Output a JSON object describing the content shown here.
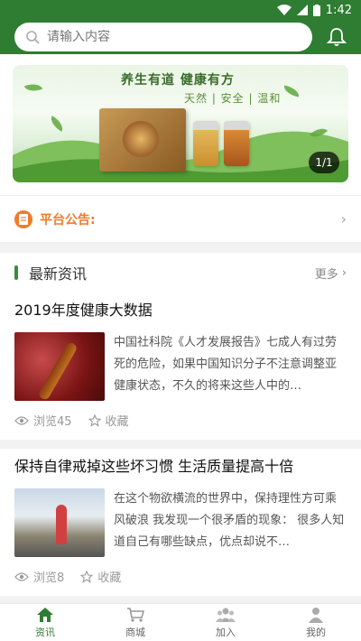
{
  "status": {
    "time": "1:42"
  },
  "search": {
    "placeholder": "请输入内容"
  },
  "banner": {
    "headline": "养生有道  健康有方",
    "subline": "天然 | 安全 | 温和",
    "pager": "1/1"
  },
  "notice": {
    "label": "平台公告:"
  },
  "news": {
    "section_title": "最新资讯",
    "more_label": "更多",
    "articles": [
      {
        "title": "2019年度健康大数据",
        "desc": "中国社科院《人才发展报告》七成人有过劳死的危险，如果中国知识分子不注意调整亚健康状态，不久的将来这些人中的…",
        "views": "浏览45",
        "fav": "收藏"
      },
      {
        "title": "保持自律戒掉这些坏习惯 生活质量提高十倍",
        "desc": "在这个物欲横流的世界中，保持理性方可乘风破浪 我发现一个很矛盾的现象： 很多人知道自己有哪些缺点，优点却说不…",
        "views": "浏览8",
        "fav": "收藏"
      }
    ]
  },
  "tabs": [
    {
      "label": "资讯",
      "icon": "home-icon"
    },
    {
      "label": "商城",
      "icon": "cart-icon"
    },
    {
      "label": "加入",
      "icon": "group-icon"
    },
    {
      "label": "我的",
      "icon": "user-icon"
    }
  ],
  "colors": {
    "primary": "#2f7d32",
    "notice": "#f07c2a"
  }
}
